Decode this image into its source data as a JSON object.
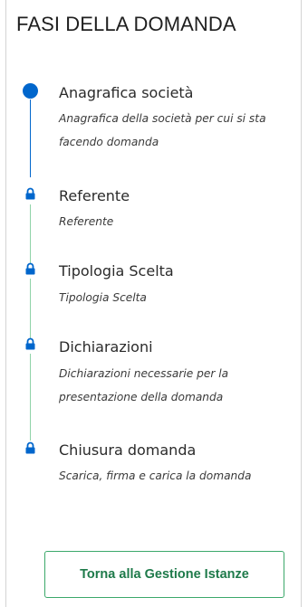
{
  "sidebar": {
    "title": "FASI DELLA DOMANDA",
    "steps": [
      {
        "title": "Anagrafica società",
        "description": "Anagrafica della società per cui si sta facendo domanda",
        "status": "current",
        "icon": "filled-circle-icon"
      },
      {
        "title": "Referente",
        "description": "Referente",
        "status": "locked",
        "icon": "lock-icon"
      },
      {
        "title": "Tipologia Scelta",
        "description": "Tipologia Scelta",
        "status": "locked",
        "icon": "lock-icon"
      },
      {
        "title": "Dichiarazioni",
        "description": "Dichiarazioni necessarie per la presentazione della domanda",
        "status": "locked",
        "icon": "lock-icon"
      },
      {
        "title": "Chiusura domanda",
        "description": "Scarica, firma e carica la domanda",
        "status": "locked",
        "icon": "lock-icon"
      }
    ],
    "back_button_label": "Torna alla Gestione Istanze"
  },
  "colors": {
    "current": "#0066cc",
    "connector_locked": "#8fd3a8",
    "button_border": "#3ba86a",
    "button_text": "#1e7a4a"
  }
}
